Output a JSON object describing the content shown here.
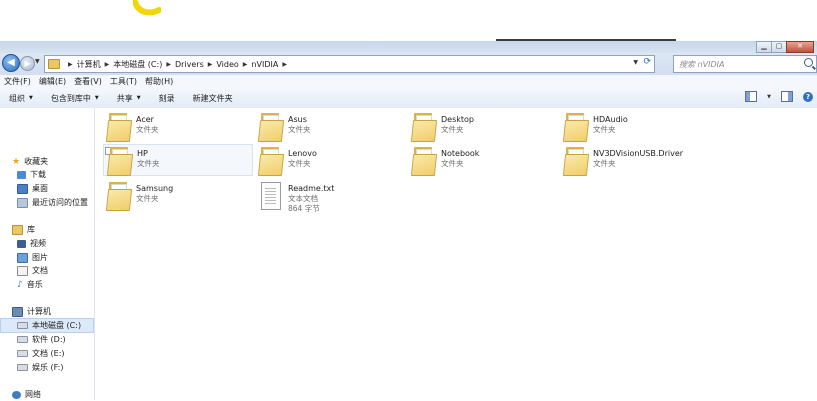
{
  "address": {
    "crumbs": [
      "计算机",
      "本地磁盘 (C:)",
      "Drivers",
      "Video",
      "nVIDIA"
    ]
  },
  "search": {
    "placeholder": "搜索 nVIDIA"
  },
  "menubar": {
    "items": [
      "文件(F)",
      "编辑(E)",
      "查看(V)",
      "工具(T)",
      "帮助(H)"
    ]
  },
  "commandbar": {
    "organize": "组织",
    "include_library": "包含到库中",
    "share": "共享",
    "burn": "刻录",
    "new_folder": "新建文件夹"
  },
  "navpane": {
    "favorites": "收藏夹",
    "downloads": "下载",
    "desktop": "桌面",
    "recent": "最近访问的位置",
    "libraries": "库",
    "videos": "视频",
    "pictures": "图片",
    "documents": "文档",
    "music": "音乐",
    "computer": "计算机",
    "drive_c": "本地磁盘 (C:)",
    "drive_d": "软件 (D:)",
    "drive_e": "文档 (E:)",
    "drive_f": "娱乐 (F:)",
    "network": "网络"
  },
  "items": [
    {
      "name": "Acer",
      "type": "文件夹"
    },
    {
      "name": "Asus",
      "type": "文件夹"
    },
    {
      "name": "Desktop",
      "type": "文件夹"
    },
    {
      "name": "HDAudio",
      "type": "文件夹"
    },
    {
      "name": "HP",
      "type": "文件夹"
    },
    {
      "name": "Lenovo",
      "type": "文件夹"
    },
    {
      "name": "Notebook",
      "type": "文件夹"
    },
    {
      "name": "NV3DVisionUSB.Driver",
      "type": "文件夹"
    },
    {
      "name": "Samsung",
      "type": "文件夹"
    },
    {
      "name": "Readme.txt",
      "type": "文本文档",
      "size": "864 字节"
    }
  ],
  "colors": {
    "window_chrome": "#dfe8f4",
    "selection": "#dce9f8",
    "folder": "#efce6c"
  },
  "icons": {
    "back": "back-arrow-icon",
    "forward": "forward-arrow-icon",
    "refresh": "refresh-icon",
    "search": "search-icon",
    "help": "help-icon"
  }
}
